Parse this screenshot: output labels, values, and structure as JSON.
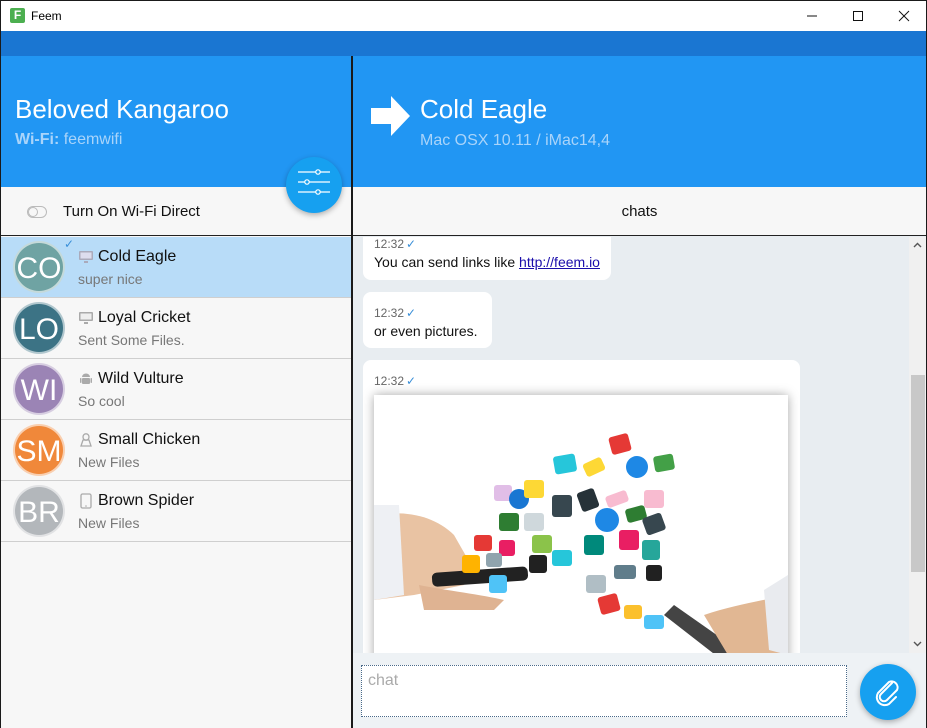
{
  "window": {
    "title": "Feem",
    "app_icon_letter": "F",
    "controls": {
      "minimize": "minimize",
      "maximize": "maximize",
      "close": "close"
    }
  },
  "colors": {
    "primary": "#2196f3",
    "primary_dark": "#1a76d2",
    "fab": "#16a0f0",
    "selected_row": "#b8dcf8",
    "subtitle": "#a9d4fa"
  },
  "local_device": {
    "name": "Beloved Kangaroo",
    "wifi_label": "Wi-Fi:",
    "wifi_name": "feemwifi",
    "settings_icon": "sliders-icon"
  },
  "wifi_direct": {
    "label": "Turn On Wi-Fi Direct",
    "enabled": false
  },
  "contacts": [
    {
      "initials": "CO",
      "name": "Cold Eagle",
      "last_message": "super nice",
      "device_icon": "desktop-icon",
      "avatar_color": "#6fa3a3",
      "selected": true,
      "checked": true
    },
    {
      "initials": "LO",
      "name": "Loyal Cricket",
      "last_message": "Sent Some Files.",
      "device_icon": "desktop-icon",
      "avatar_color": "#3c7385",
      "selected": false,
      "checked": false
    },
    {
      "initials": "WI",
      "name": "Wild Vulture",
      "last_message": "So cool",
      "device_icon": "android-icon",
      "avatar_color": "#9b84b5",
      "selected": false,
      "checked": false
    },
    {
      "initials": "SM",
      "name": "Small Chicken",
      "last_message": "New Files",
      "device_icon": "linux-icon",
      "avatar_color": "#f0883a",
      "selected": false,
      "checked": false
    },
    {
      "initials": "BR",
      "name": "Brown Spider",
      "last_message": "New Files",
      "device_icon": "tablet-icon",
      "avatar_color": "#b3b7bb",
      "selected": false,
      "checked": false
    }
  ],
  "peer": {
    "name": "Cold Eagle",
    "os": "Mac OSX 10.11 / iMac14,4",
    "direction_icon": "arrow-right-icon"
  },
  "tab": {
    "label": "chats"
  },
  "messages": [
    {
      "time": "12:32",
      "tick": "✓",
      "text": "You can send links like ",
      "link": "http://feem.io"
    },
    {
      "time": "12:32",
      "tick": "✓",
      "text": "or even pictures."
    },
    {
      "time": "12:32",
      "tick": "✓",
      "image": "apps-flying-between-phones-picture"
    }
  ],
  "composer": {
    "placeholder": "chat",
    "value": "",
    "attach_icon": "paperclip-icon"
  },
  "scrollbar": {
    "up": "▲",
    "down": "▼"
  }
}
